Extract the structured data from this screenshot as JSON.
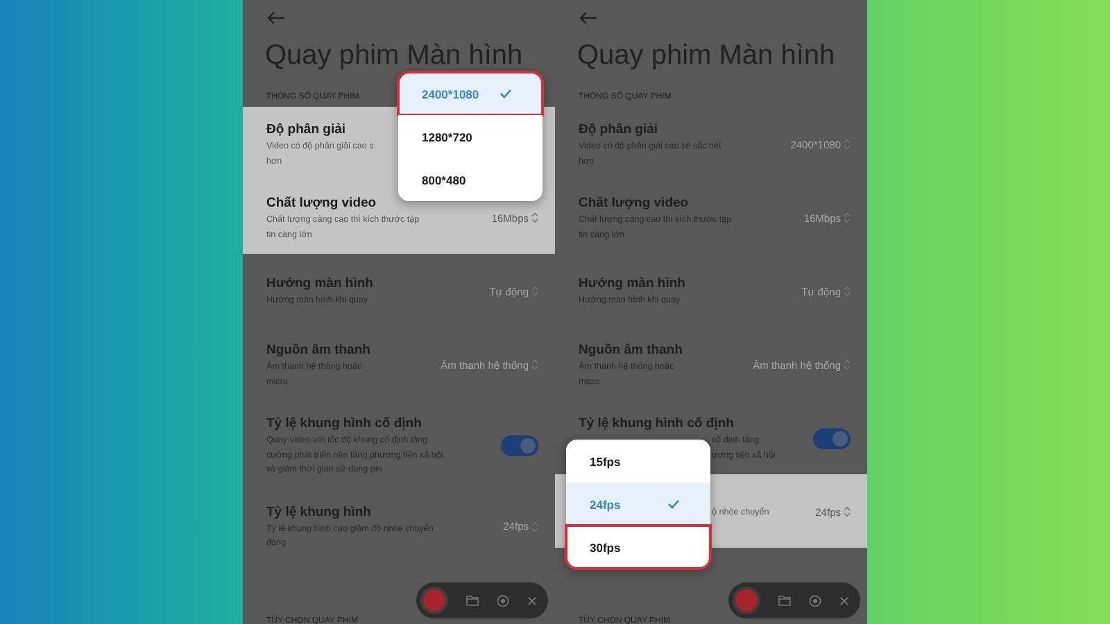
{
  "phones": [
    {
      "title": "Quay phim Màn hình",
      "section": "THÔNG SỐ QUAY PHIM",
      "footer_section": "TÙY CHỌN QUAY PHIM",
      "rows": [
        {
          "kind": "value",
          "title": "Độ phân giải",
          "desc": [
            "Video có độ phân giải cao s",
            "hơn"
          ],
          "highlighted": true,
          "menu": {
            "items": [
              {
                "label": "2400*1080",
                "selected": true,
                "outlined": true
              },
              {
                "label": "1280*720",
                "selected": false,
                "outlined": false
              },
              {
                "label": "800*480",
                "selected": false,
                "outlined": false
              }
            ]
          }
        },
        {
          "kind": "value",
          "title": "Chất lượng video",
          "desc": [
            "Chất lượng càng cao thì kích thước tập",
            "tin càng lớn"
          ],
          "value": "16Mbps",
          "highlighted": true
        },
        {
          "kind": "value",
          "title": "Hướng màn hình",
          "desc": [
            "Hướng màn hình khi quay"
          ],
          "value": "Tự động",
          "highlighted": false
        },
        {
          "kind": "value",
          "title": "Nguồn âm thanh",
          "desc": [
            "Âm thanh hệ thống hoặc",
            "micro"
          ],
          "value": "Âm thanh hệ thống",
          "highlighted": false
        },
        {
          "kind": "toggle",
          "title": "Tỷ lệ khung hình cố định",
          "desc": [
            "Quay video với tốc độ khung cố định tăng",
            "cường phát triển nền tảng phương tiện xã hội",
            "và giảm thời gian sử dụng pin"
          ],
          "on": true,
          "highlighted": false
        },
        {
          "kind": "value",
          "title": "Tỷ lệ khung hình",
          "desc": [
            "Tỷ lệ khung hình cao giảm độ nhòe chuyển",
            "động"
          ],
          "value": "24fps",
          "highlighted": false
        }
      ]
    },
    {
      "title": "Quay phim Màn hình",
      "section": "THÔNG SỐ QUAY PHIM",
      "footer_section": "TÙY CHỌN QUAY PHIM",
      "rows": [
        {
          "kind": "value",
          "title": "Độ phân giải",
          "desc": [
            "Video có độ phân giải cao sẽ sắc nét",
            "hơn"
          ],
          "value": "2400*1080",
          "highlighted": false
        },
        {
          "kind": "value",
          "title": "Chất lượng video",
          "desc": [
            "Chất lượng càng cao thì kích thước tập",
            "tin càng lớn"
          ],
          "value": "16Mbps",
          "highlighted": false
        },
        {
          "kind": "value",
          "title": "Hướng màn hình",
          "desc": [
            "Hướng màn hình khi quay"
          ],
          "value": "Tự động",
          "highlighted": false
        },
        {
          "kind": "value",
          "title": "Nguồn âm thanh",
          "desc": [
            "Âm thanh hệ thống hoặc",
            "micro"
          ],
          "value": "Âm thanh hệ thống",
          "highlighted": false
        },
        {
          "kind": "toggle",
          "title": "Tỷ lệ khung hình cố định",
          "desc": [
            "cố định tăng",
            "ương tiện xã hội"
          ],
          "desc_covered": true,
          "on": true,
          "highlighted": false
        },
        {
          "kind": "value",
          "desc": [
            "ộ nhòe chuyển"
          ],
          "desc_covered": true,
          "value": "24fps",
          "highlighted": true,
          "menu": {
            "items": [
              {
                "label": "15fps",
                "selected": false,
                "outlined": false
              },
              {
                "label": "24fps",
                "selected": true,
                "outlined": false
              },
              {
                "label": "30fps",
                "selected": false,
                "outlined": true
              }
            ]
          }
        }
      ]
    }
  ]
}
